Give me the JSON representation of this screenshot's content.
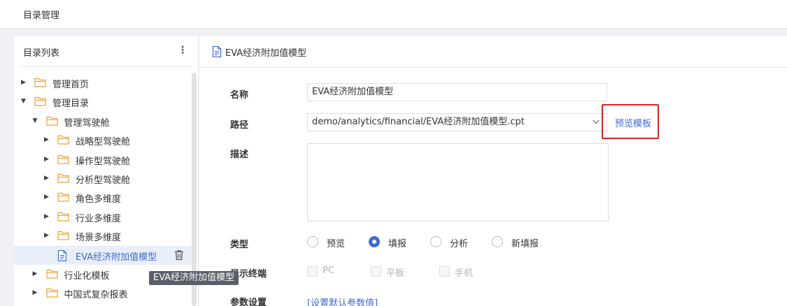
{
  "header": {
    "title": "目录管理"
  },
  "sidebar": {
    "title": "目录列表",
    "more_icon": "more-vertical-icon",
    "tree": [
      {
        "label": "管理首页",
        "expanded": false,
        "type": "folder"
      },
      {
        "label": "管理目录",
        "expanded": true,
        "type": "folder"
      },
      {
        "label": "管理驾驶舱",
        "expanded": true,
        "type": "folder"
      },
      {
        "label": "战略型驾驶舱",
        "expanded": false,
        "type": "folder"
      },
      {
        "label": "操作型驾驶舱",
        "expanded": false,
        "type": "folder"
      },
      {
        "label": "分析型驾驶舱",
        "expanded": false,
        "type": "folder"
      },
      {
        "label": "角色多维度",
        "expanded": false,
        "type": "folder"
      },
      {
        "label": "行业多维度",
        "expanded": false,
        "type": "folder"
      },
      {
        "label": "场景多维度",
        "expanded": false,
        "type": "folder"
      },
      {
        "label": "EVA经济附加值模型",
        "type": "file",
        "selected": true
      },
      {
        "label": "行业化模板",
        "expanded": false,
        "type": "folder"
      },
      {
        "label": "中国式复杂报表",
        "expanded": false,
        "type": "folder"
      }
    ],
    "tooltip": "EVA经济附加值模型"
  },
  "main": {
    "title": "EVA经济附加值模型",
    "form": {
      "name_label": "名称",
      "name_value": "EVA经济附加值模型",
      "path_label": "路径",
      "path_value": "demo/analytics/financial/EVA经济附加值模型.cpt",
      "preview_link": "预览模板",
      "desc_label": "描述",
      "desc_value": "",
      "type_label": "类型",
      "type_options": [
        "预览",
        "填报",
        "分析",
        "新填报"
      ],
      "type_selected": "填报",
      "terminal_label": "显示终端",
      "terminal_options": [
        "PC",
        "平板",
        "手机"
      ],
      "params_label": "参数设置",
      "params_link": "[设置默认参数值]"
    }
  },
  "colors": {
    "accent": "#3d6bd0",
    "folder": "#f0a03c",
    "highlight_box": "#e02020",
    "selected_bg": "#e9effa"
  }
}
